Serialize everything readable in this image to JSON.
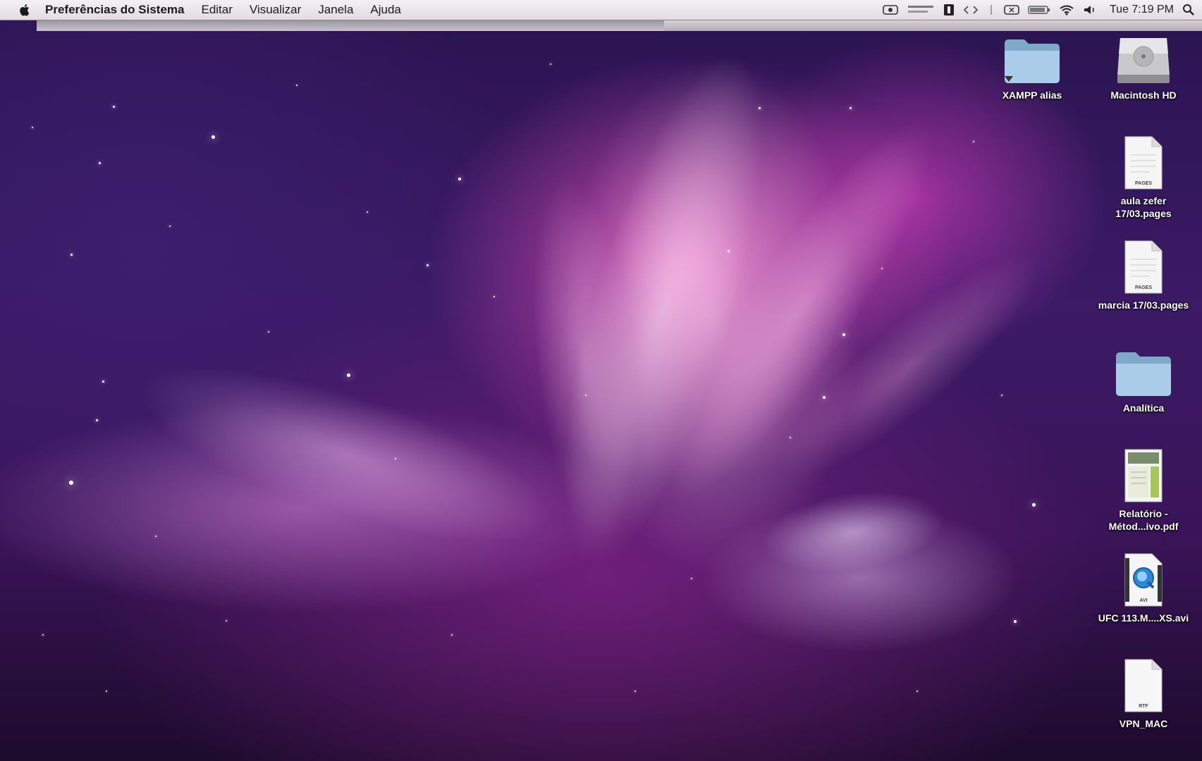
{
  "menubar": {
    "app_name": "Preferências do Sistema",
    "menus": [
      "Editar",
      "Visualizar",
      "Janela",
      "Ajuda"
    ],
    "status_items": {
      "clock": "Tue 7:19 PM"
    }
  },
  "desktop": {
    "icons": [
      {
        "label": "XAMPP alias",
        "icon": "folder-icon"
      },
      {
        "label": "Macintosh HD",
        "icon": "hard-drive-icon"
      },
      {
        "label": "aula zefer 17/03.pages",
        "icon": "pages-document-icon",
        "badge": "PAGES"
      },
      {
        "label": "marcia 17/03.pages",
        "icon": "pages-document-icon",
        "badge": "PAGES"
      },
      {
        "label": "Analítica",
        "icon": "folder-icon"
      },
      {
        "label": "Relatório - Métod...ivo.pdf",
        "icon": "pdf-document-icon"
      },
      {
        "label": "UFC 113.M....XS.avi",
        "icon": "quicktime-movie-icon",
        "badge": "AVI"
      },
      {
        "label": "VPN_MAC",
        "icon": "rtf-document-icon",
        "badge": "RTF"
      }
    ]
  },
  "colors": {
    "menubar": "#ece6ea",
    "folder": "#9cc3e0",
    "wallpaper_accent": "#e24fb8"
  }
}
